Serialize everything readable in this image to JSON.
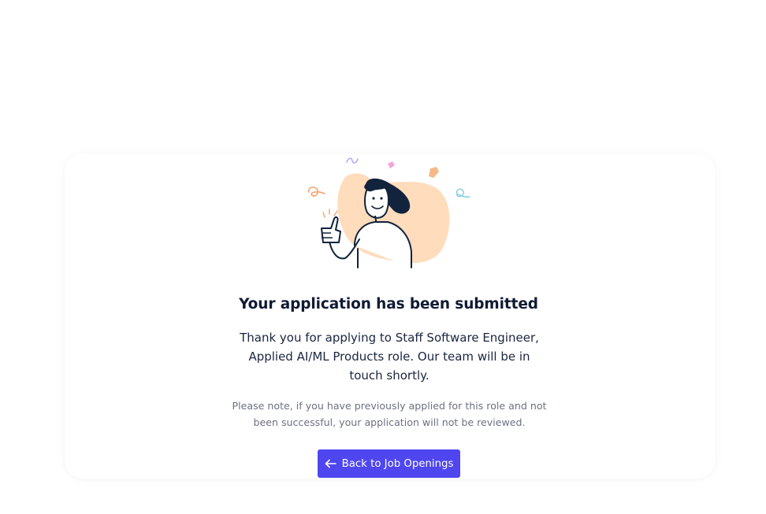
{
  "confirmation": {
    "title": "Your application has been submitted",
    "message": "Thank you for applying to Staff Software Engineer, Applied AI/ML Products role. Our team will be in touch shortly.",
    "note": "Please note, if you have previously applied for this role and not been successful, your application will not be reviewed."
  },
  "actions": {
    "back_label": "Back to Job Openings",
    "back_icon": "arrow-left-icon"
  },
  "illustration": {
    "name": "thumbs-up-person-illustration",
    "blob_color": "#ffdcbc",
    "ink_color": "#12233d"
  },
  "colors": {
    "accent": "#4f46f0",
    "title": "#101a33",
    "body": "#1b2540",
    "muted": "#6b7280"
  }
}
